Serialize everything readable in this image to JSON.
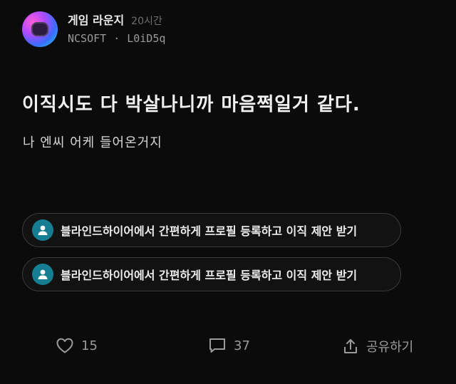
{
  "post": {
    "channel": "게임 라운지",
    "time_ago": "20시간",
    "company": "NCSOFT",
    "separator": "·",
    "author_id": "L0iD5q",
    "title": "이직시도 다 박살나니까 마음쩍일거 같다.",
    "body": "나 엔씨 어케 들어온거지"
  },
  "promos": [
    {
      "text": "블라인드하이어에서 간편하게 프로필 등록하고 이직 제안 받기"
    },
    {
      "text": "블라인드하이어에서 간편하게 프로필 등록하고 이직 제안 받기"
    }
  ],
  "actions": {
    "likes": "15",
    "comments": "37",
    "share_label": "공유하기"
  },
  "icons": {
    "avatar": "channel-avatar",
    "promo": "user-icon",
    "like": "heart-icon",
    "comment": "comment-icon",
    "share": "share-icon"
  },
  "colors": {
    "background": "#0b0b0b",
    "promo_icon": "#167e93",
    "muted": "#9b9b9b"
  }
}
